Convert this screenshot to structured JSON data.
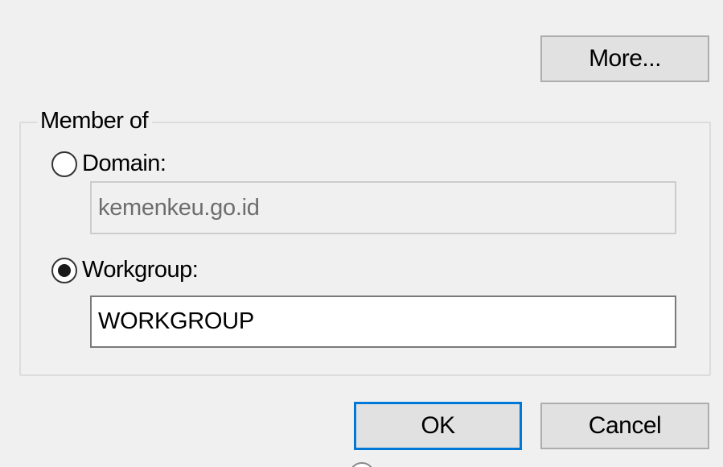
{
  "buttons": {
    "more_label": "More...",
    "ok_label": "OK",
    "cancel_label": "Cancel"
  },
  "member_of": {
    "legend": "Member of",
    "domain": {
      "label": "Domain:",
      "selected": false,
      "value": "kemenkeu.go.id",
      "enabled": false
    },
    "workgroup": {
      "label": "Workgroup:",
      "selected": true,
      "value": "WORKGROUP",
      "enabled": true
    }
  },
  "colors": {
    "dialog_background": "#f0f0f0",
    "button_background": "#e1e1e1",
    "focus_border": "#0078d7",
    "disabled_text": "#6d6d6d"
  }
}
